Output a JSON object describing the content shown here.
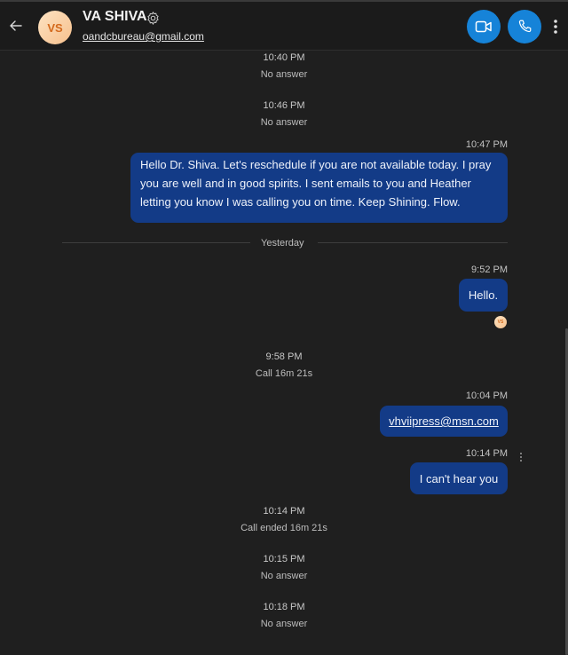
{
  "header": {
    "avatar_initials": "VS",
    "contact_name": "VA SHIVA",
    "contact_email": "oandcbureau@gmail.com",
    "icons": {
      "back": "arrow-left-icon",
      "settings": "gear-icon",
      "video": "video-camera-icon",
      "call": "phone-icon",
      "more": "more-vertical-icon"
    }
  },
  "messages": {
    "event1": {
      "time": "10:40 PM",
      "status": "No answer"
    },
    "event2": {
      "time": "10:46 PM",
      "status": "No answer"
    },
    "msg1": {
      "time": "10:47 PM",
      "text": "Hello Dr. Shiva. Let's reschedule if you are not available today. I pray you are well and in good spirits. I sent emails to you and Heather letting you know I was calling you on time. Keep Shining. Flow."
    },
    "day_divider": "Yesterday",
    "msg2": {
      "time": "9:52 PM",
      "text": "Hello."
    },
    "read_receipt_initials": "VS",
    "event3": {
      "time": "9:58 PM",
      "status": "Call 16m 21s"
    },
    "msg3": {
      "time": "10:04 PM",
      "text": "vhviipress@msn.com"
    },
    "msg4": {
      "time": "10:14 PM",
      "text": "I can't hear you"
    },
    "event4": {
      "time": "10:14 PM",
      "status": "Call ended 16m 21s"
    },
    "event5": {
      "time": "10:15 PM",
      "status": "No answer"
    },
    "event6": {
      "time": "10:18 PM",
      "status": "No answer"
    }
  },
  "colors": {
    "background": "#1f1f1f",
    "bubble": "#133b87",
    "accent": "#1683d8",
    "avatar": "#f7c08d"
  }
}
